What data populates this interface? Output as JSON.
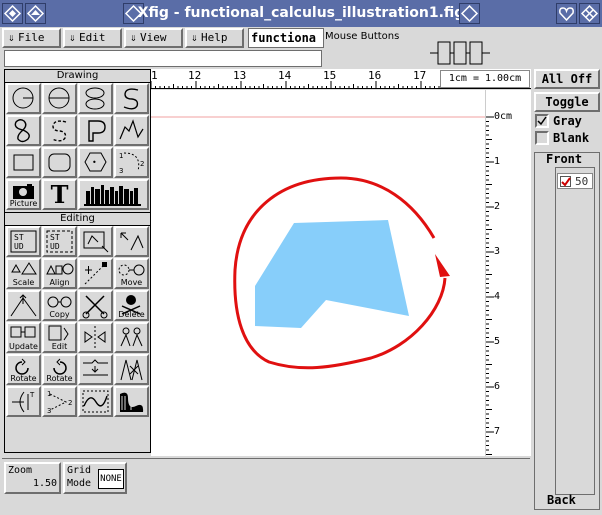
{
  "window": {
    "title": "Xfig - functional_calculus_illustration1.fig"
  },
  "menu": {
    "file": "File",
    "edit": "Edit",
    "view": "View",
    "help": "Help",
    "filename_display": "functiona",
    "mouse_buttons_label": "Mouse Buttons"
  },
  "mode_panel": {
    "drawing_header": "Drawing",
    "editing_header": "Editing",
    "picture_label": "Picture",
    "text_label": "T",
    "scale_label": "Scale",
    "align_label": "Align",
    "move_label": "Move",
    "copy_label": "Copy",
    "delete_label": "Delete",
    "update_label": "Update",
    "edit_label": "Edit",
    "rotate_label_1": "Rotate",
    "rotate_label_2": "Rotate"
  },
  "ruler": {
    "unit": "1cm = 1.00cm",
    "top_ticks": [
      "1",
      "12",
      "13",
      "14",
      "15",
      "16",
      "17"
    ],
    "side_ticks": [
      "0cm",
      "1",
      "2",
      "3",
      "4",
      "5",
      "6",
      "7"
    ]
  },
  "depth_panel": {
    "all_off": "All Off",
    "toggle": "Toggle",
    "gray": "Gray",
    "blank": "Blank",
    "front": "Front",
    "layer_value": "50",
    "back": "Back"
  },
  "bottom_panel": {
    "zoom_label": "Zoom",
    "zoom_value": "1.50",
    "grid_mode_label_1": "Grid",
    "grid_mode_label_2": "Mode",
    "grid_mode_value": "NONE"
  },
  "colors": {
    "titlebar": "#5a6da7",
    "polygon_fill": "#87cefa",
    "curve_stroke": "#e01010",
    "guide_line": "#f2a0a0",
    "check_mark": "#cc0000"
  }
}
